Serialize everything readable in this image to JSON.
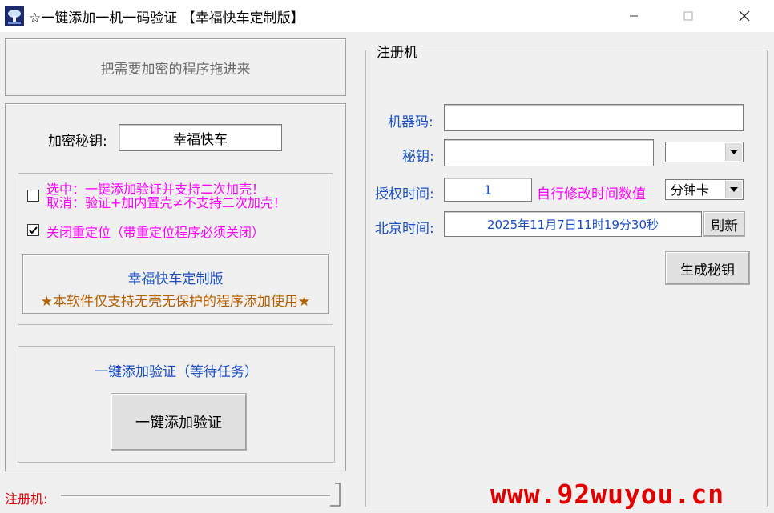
{
  "window": {
    "title": "☆一键添加一机一码验证 【幸福快车定制版】",
    "controls": {
      "minimize": "—",
      "maximize": "☐",
      "close": "✕"
    }
  },
  "left": {
    "drop_zone_text": "把需要加密的程序拖进来",
    "secret_key_label": "加密秘钥:",
    "secret_key_value": "幸福快车",
    "option1_line1": "选中：一键添加验证并支持二次加壳！",
    "option1_line2": "取消：验证+加内置壳≠不支持二次加壳！",
    "option1_checked": false,
    "option2_label": "关闭重定位（带重定位程序必须关闭）",
    "option2_checked": true,
    "info_title": "幸福快车定制版",
    "info_note": "★本软件仅支持无壳无保护的程序添加使用★",
    "task_status": "一键添加验证（等待任务）",
    "add_button": "一键添加验证",
    "footer_label": "注册机:"
  },
  "right": {
    "group_title": "注册机",
    "machine_code_label": "机器码:",
    "machine_code_value": "",
    "secret_label": "秘钥:",
    "secret_value": "",
    "secret_combo_value": "",
    "auth_time_label": "授权时间:",
    "auth_time_value": "1",
    "auth_time_hint": "自行修改时间数值",
    "time_unit_value": "分钟卡",
    "beijing_time_label": "北京时间:",
    "beijing_time_value": "2025年11月7日11时19分30秒",
    "refresh_button": "刷新",
    "generate_button": "生成秘钥"
  },
  "watermark": "www.92wuyou.cn",
  "colors": {
    "accent_blue": "#1a4fc4",
    "magenta": "#ff00ff",
    "orange": "#b45f00",
    "red": "#e10000"
  }
}
